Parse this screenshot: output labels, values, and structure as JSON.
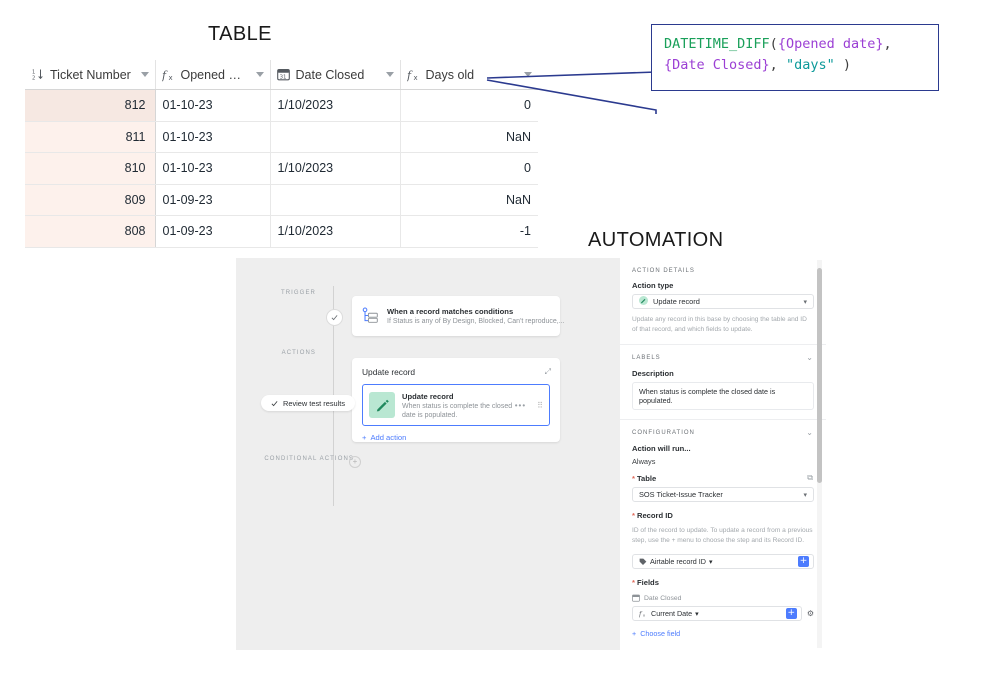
{
  "captions": {
    "table": "TABLE",
    "automation": "AUTOMATION"
  },
  "table": {
    "columns": [
      {
        "label": "Ticket Number",
        "icon": "sort-number-icon",
        "align": "right"
      },
      {
        "label": "Opened date",
        "icon": "formula-fx-icon",
        "align": "left"
      },
      {
        "label": "Date Closed",
        "icon": "calendar-icon",
        "align": "left"
      },
      {
        "label": "Days old",
        "icon": "formula-fx-icon",
        "align": "right"
      }
    ],
    "rows": [
      {
        "ticket": "812",
        "opened": "01-10-23",
        "closed": "1/10/2023",
        "days": "0"
      },
      {
        "ticket": "811",
        "opened": "01-10-23",
        "closed": "",
        "days": "NaN"
      },
      {
        "ticket": "810",
        "opened": "01-10-23",
        "closed": "1/10/2023",
        "days": "0"
      },
      {
        "ticket": "809",
        "opened": "01-09-23",
        "closed": "",
        "days": "NaN"
      },
      {
        "ticket": "808",
        "opened": "01-09-23",
        "closed": "1/10/2023",
        "days": "-1"
      }
    ]
  },
  "formula_callout": {
    "line1": {
      "fn": "DATETIME_DIFF",
      "open_paren": "(",
      "field1": "{Opened date}",
      "comma": ","
    },
    "line2": {
      "field2": "{Date Closed}",
      "comma": ",",
      "string": "\"days\"",
      "close_paren": ")"
    },
    "full_text": "DATETIME_DIFF({Opened date}, {Date Closed}, \"days\" )",
    "border_color": "#2b3a8f",
    "colors": {
      "function": "#1aa05a",
      "field": "#9b3fd4",
      "string": "#0d9a9a",
      "punctuation": "#3d3d3d"
    }
  },
  "automation": {
    "flow": {
      "trigger_label": "TRIGGER",
      "actions_label": "ACTIONS",
      "conditional_label": "CONDITIONAL ACTIONS",
      "trigger_card": {
        "title": "When a record matches conditions",
        "subtitle": "If Status is any of By Design, Blocked, Can't reproduce,..."
      },
      "actions_card": {
        "title": "Update record",
        "item_title": "Update record",
        "item_subtitle_line1": "When status is complete the closed",
        "item_subtitle_line2": "date is populated.",
        "add_action_label": "Add action"
      },
      "review_pill_label": "Review test results"
    },
    "details": {
      "section_action_details": "ACTION DETAILS",
      "action_type_label": "Action type",
      "action_type_value": "Update record",
      "action_type_helper": "Update any record in this base by choosing the table and ID of that record, and which fields to update.",
      "section_labels": "LABELS",
      "description_label": "Description",
      "description_value": "When status is complete the closed date is populated.",
      "section_configuration": "CONFIGURATION",
      "run_when_label": "Action will run...",
      "run_when_value": "Always",
      "table_label": "Table",
      "table_value": "SOS Ticket-Issue Tracker",
      "record_id_label": "Record ID",
      "record_id_helper": "ID of the record to update. To update a record from a previous step, use the + menu to choose the step and its Record ID.",
      "record_id_token": "Airtable record ID",
      "fields_label": "Fields",
      "field_name": "Date Closed",
      "field_value_token": "Current Date",
      "choose_field_label": "Choose field"
    }
  }
}
